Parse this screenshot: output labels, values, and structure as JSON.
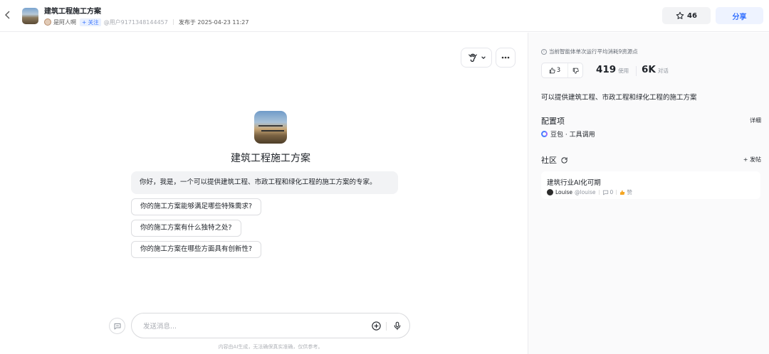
{
  "header": {
    "back_icon": "chevron-left-icon",
    "app_title": "建筑工程施工方案",
    "author_name": "是阿人啊",
    "follow_label": "+ 关注",
    "user_id": "@用户9171348144457",
    "published": "发布于 2025-04-23 11:27",
    "star_count": "46",
    "share_label": "分享"
  },
  "chat": {
    "bot_name": "建筑工程施工方案",
    "greeting": "你好，我是，一个可以提供建筑工程、市政工程和绿化工程的施工方案的专家。",
    "suggestions": [
      "你的施工方案能够满足哪些特殊需求?",
      "你的施工方案有什么独特之处?",
      "你的施工方案在哪些方面具有创新性?"
    ],
    "input_placeholder": "发送消息...",
    "disclaimer": "内容由AI生成，无法确保真实准确，仅供参考。"
  },
  "panel": {
    "note": "当前智能体单次运行平均消耗9资源点",
    "likes": "3",
    "uses_num": "419",
    "uses_label": "使用",
    "chats_num": "6K",
    "chats_label": "对话",
    "description": "可以提供建筑工程、市政工程和绿化工程的施工方案",
    "config_title": "配置项",
    "config_detail": "详细",
    "config_item": "豆包 · 工具调用",
    "community_title": "社区",
    "post_button": "+ 发帖",
    "post": {
      "title": "建筑行业AI化可期",
      "author": "Louise",
      "handle": "@louise",
      "comments": "0",
      "like_label": "赞"
    }
  },
  "colors": {
    "accent": "#3370ff",
    "background": "#ffffff",
    "panel_bg": "#fafafb"
  }
}
